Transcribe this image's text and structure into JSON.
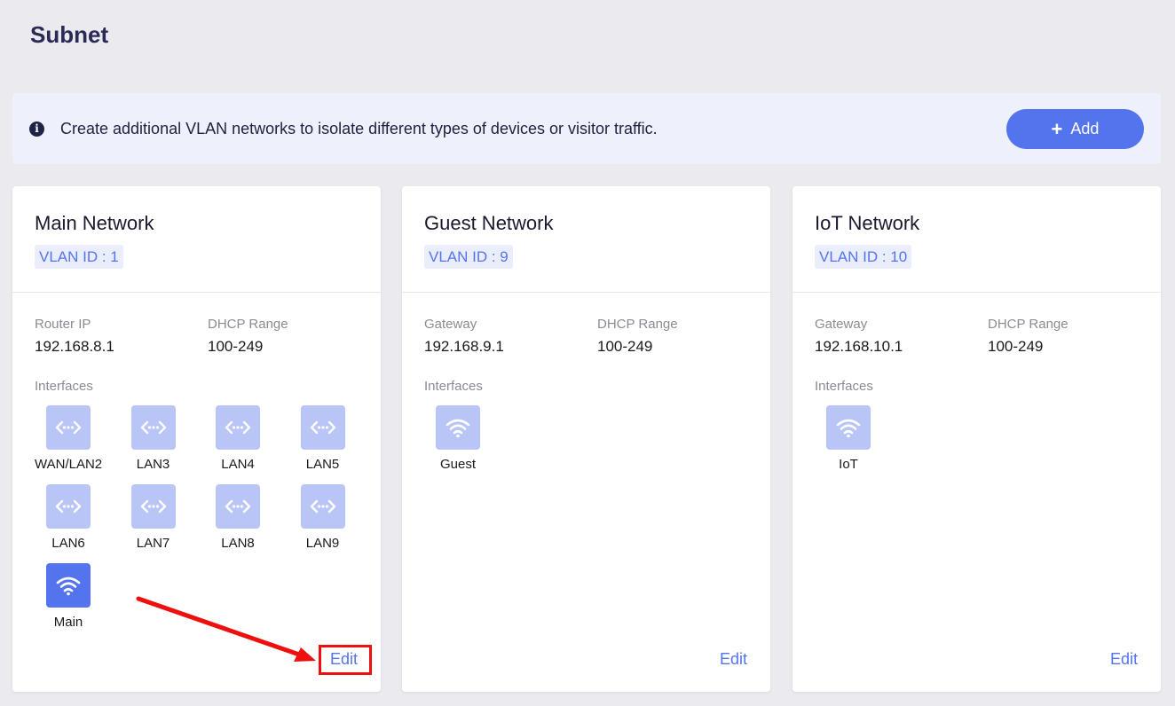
{
  "page": {
    "title": "Subnet"
  },
  "banner": {
    "icon": "info-icon",
    "text": "Create additional VLAN networks to isolate different types of devices or visitor traffic.",
    "add_label": "Add"
  },
  "colors": {
    "accent": "#5474ee",
    "icon_inactive": "#b9c5f6",
    "annotation": "#ee0f0f"
  },
  "cards": [
    {
      "title": "Main Network",
      "vlan": "VLAN ID : 1",
      "ip_label": "Router IP",
      "ip_value": "192.168.8.1",
      "dhcp_label": "DHCP Range",
      "dhcp_value": "100-249",
      "interfaces_label": "Interfaces",
      "interfaces": [
        {
          "label": "WAN/LAN2",
          "icon": "ethernet-icon"
        },
        {
          "label": "LAN3",
          "icon": "ethernet-icon"
        },
        {
          "label": "LAN4",
          "icon": "ethernet-icon"
        },
        {
          "label": "LAN5",
          "icon": "ethernet-icon"
        },
        {
          "label": "LAN6",
          "icon": "ethernet-icon"
        },
        {
          "label": "LAN7",
          "icon": "ethernet-icon"
        },
        {
          "label": "LAN8",
          "icon": "ethernet-icon"
        },
        {
          "label": "LAN9",
          "icon": "ethernet-icon"
        },
        {
          "label": "Main",
          "icon": "wifi-icon",
          "active": true
        }
      ],
      "edit_label": "Edit"
    },
    {
      "title": "Guest Network",
      "vlan": "VLAN ID : 9",
      "ip_label": "Gateway",
      "ip_value": "192.168.9.1",
      "dhcp_label": "DHCP Range",
      "dhcp_value": "100-249",
      "interfaces_label": "Interfaces",
      "interfaces": [
        {
          "label": "Guest",
          "icon": "wifi-icon"
        }
      ],
      "edit_label": "Edit"
    },
    {
      "title": "IoT Network",
      "vlan": "VLAN ID : 10",
      "ip_label": "Gateway",
      "ip_value": "192.168.10.1",
      "dhcp_label": "DHCP Range",
      "dhcp_value": "100-249",
      "interfaces_label": "Interfaces",
      "interfaces": [
        {
          "label": "IoT",
          "icon": "wifi-icon"
        }
      ],
      "edit_label": "Edit"
    }
  ]
}
